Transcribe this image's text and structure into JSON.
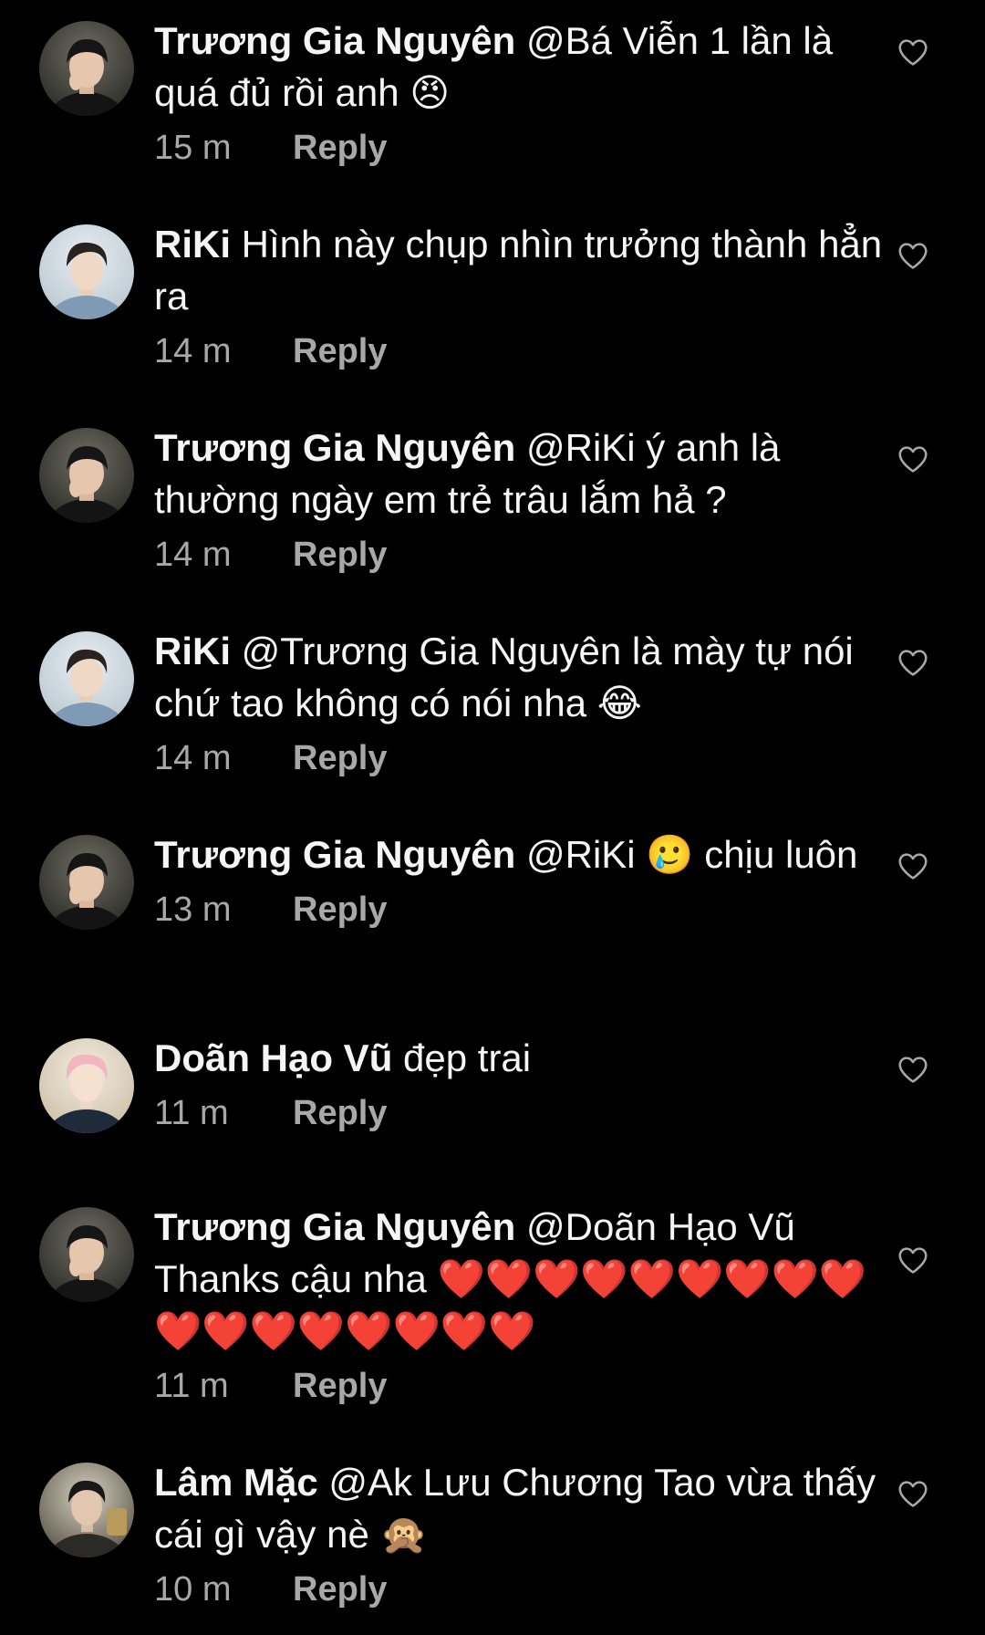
{
  "colors": {
    "background": "#000000",
    "text": "#f5f5f5",
    "secondary_text": "#a8a8a8"
  },
  "icons": {
    "like": "heart-outline-icon"
  },
  "comments": [
    {
      "avatar": "avatar-truong-gia-nguyen",
      "username": "Trương Gia Nguyên",
      "content": " @Bá Viễn 1 lần là quá đủ rồi anh 😠",
      "time": "15 m",
      "reply_label": "Reply"
    },
    {
      "avatar": "avatar-riki",
      "username": "RiKi",
      "content": " Hình này chụp nhìn trưởng thành hẳn ra",
      "time": "14 m",
      "reply_label": "Reply"
    },
    {
      "avatar": "avatar-truong-gia-nguyen",
      "username": "Trương Gia Nguyên",
      "content": " @RiKi ý anh là thường ngày em trẻ trâu lắm hả ?",
      "time": "14 m",
      "reply_label": "Reply"
    },
    {
      "avatar": "avatar-riki",
      "username": "RiKi",
      "content": " @Trương Gia Nguyên là mày tự nói chứ tao không có nói nha 😂",
      "time": "14 m",
      "reply_label": "Reply"
    },
    {
      "avatar": "avatar-truong-gia-nguyen",
      "username": "Trương Gia Nguyên",
      "content": " @RiKi 🥲 chịu luôn",
      "time": "13 m",
      "reply_label": "Reply"
    },
    {
      "avatar": "avatar-doan-hao-vu",
      "username": "Doãn Hạo Vũ",
      "content": " đẹp trai",
      "time": "11 m",
      "reply_label": "Reply"
    },
    {
      "avatar": "avatar-truong-gia-nguyen",
      "username": "Trương Gia Nguyên",
      "content": " @Doãn Hạo Vũ Thanks cậu nha ❤️❤️❤️❤️❤️❤️❤️❤️❤️❤️❤️❤️❤️❤️❤️❤️❤️",
      "time": "11 m",
      "reply_label": "Reply"
    },
    {
      "avatar": "avatar-lam-mac",
      "username": "Lâm Mặc",
      "content": " @Ak Lưu Chương Tao vừa thấy cái gì vậy nè 🙊",
      "time": "10 m",
      "reply_label": "Reply"
    }
  ]
}
